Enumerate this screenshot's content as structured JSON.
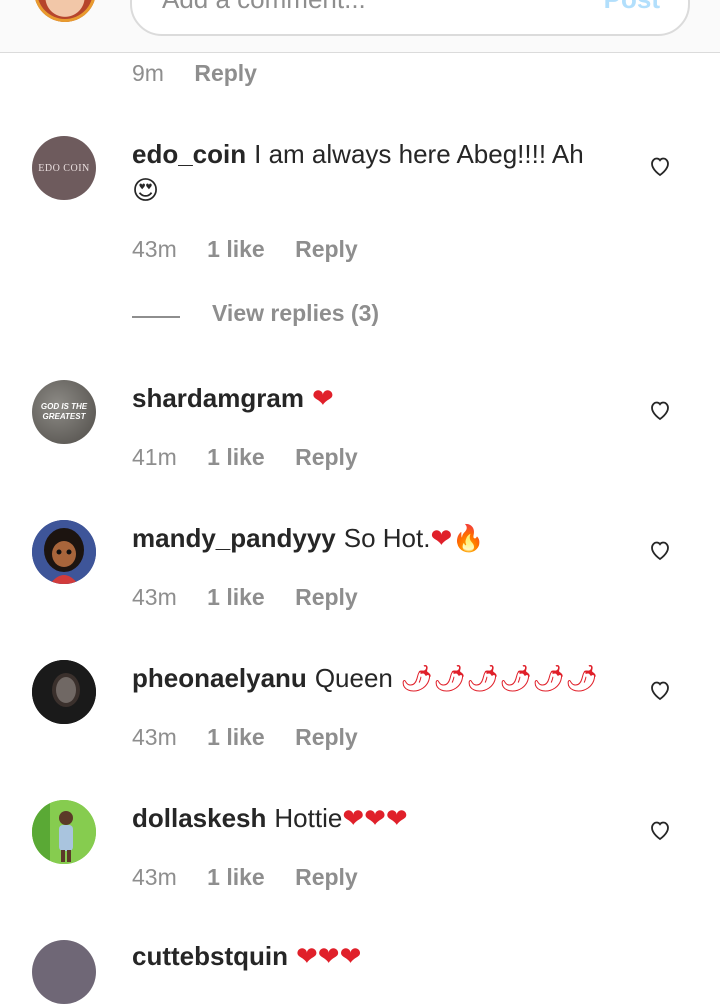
{
  "composer": {
    "placeholder": "Add a comment...",
    "post_label": "Post"
  },
  "prev_comment_meta": {
    "time": "9m",
    "reply": "Reply"
  },
  "comments": [
    {
      "username": "edo_coin",
      "text": "I am always here Abeg!!!! Ah",
      "emoji": "😍",
      "time": "43m",
      "likes": "1 like",
      "reply": "Reply",
      "avatar_text": "EDO COIN",
      "view_replies": "View replies (3)"
    },
    {
      "username": "shardamgram",
      "text": "",
      "emoji": "❤",
      "time": "41m",
      "likes": "1 like",
      "reply": "Reply",
      "avatar_text": "GOD IS THE GREATEST"
    },
    {
      "username": "mandy_pandyyy",
      "text": "So Hot.",
      "emoji": "❤",
      "emoji2": "🔥",
      "time": "43m",
      "likes": "1 like",
      "reply": "Reply"
    },
    {
      "username": "pheonaelyanu",
      "text": "Queen",
      "emoji": "🌶🌶🌶🌶🌶🌶",
      "time": "43m",
      "likes": "1 like",
      "reply": "Reply"
    },
    {
      "username": "dollaskesh",
      "text": "Hottie",
      "emoji": "❤❤❤",
      "time": "43m",
      "likes": "1 like",
      "reply": "Reply"
    },
    {
      "username": "cuttebstquin",
      "text": "",
      "emoji": "❤❤❤"
    }
  ],
  "colors": {
    "text": "#262626",
    "secondary": "#8e8e8e",
    "heart_red": "#e0202a"
  }
}
